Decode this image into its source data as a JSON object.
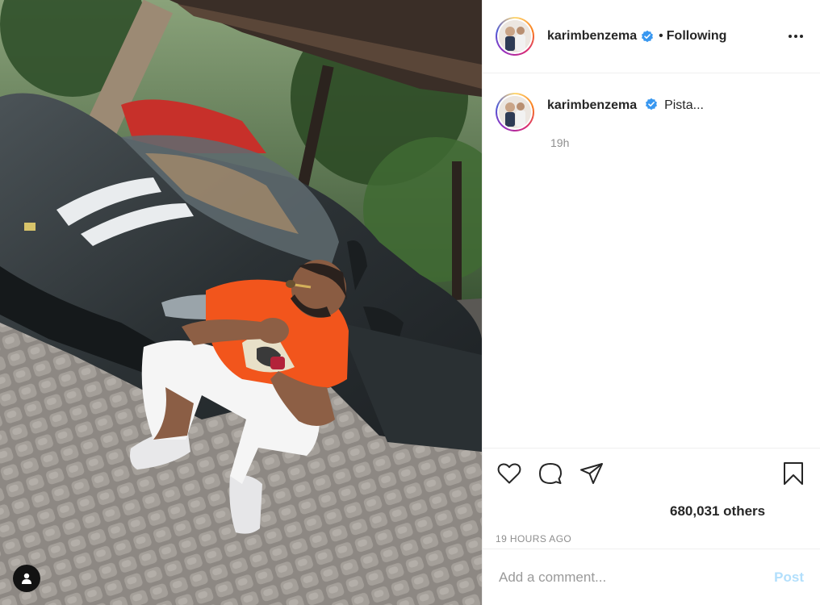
{
  "post": {
    "author": {
      "username": "karimbenzema",
      "verified_icon": "verified-badge-icon",
      "follow_status": "Following"
    },
    "caption": {
      "username": "karimbenzema",
      "text": "Pista...",
      "relative_time": "19h"
    },
    "likes_text": "680,031 others",
    "timestamp": "19 HOURS AGO",
    "comment": {
      "placeholder": "Add a comment...",
      "post_label": "Post"
    }
  },
  "icons": {
    "like": "heart-icon",
    "comment": "comment-bubble-icon",
    "share": "paper-plane-icon",
    "save": "bookmark-icon",
    "more": "more-options-icon",
    "tags": "user-tag-icon"
  },
  "colors": {
    "accent_blue": "#0095f6",
    "verified_blue": "#3897f0",
    "post_disabled": "#b2dffc",
    "muted_text": "#8e8e8e"
  }
}
